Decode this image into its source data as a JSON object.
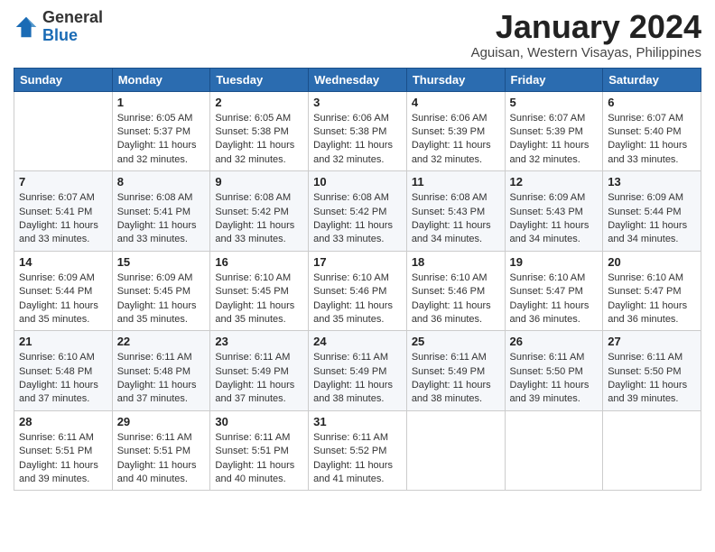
{
  "header": {
    "logo_general": "General",
    "logo_blue": "Blue",
    "month_title": "January 2024",
    "location": "Aguisan, Western Visayas, Philippines"
  },
  "weekdays": [
    "Sunday",
    "Monday",
    "Tuesday",
    "Wednesday",
    "Thursday",
    "Friday",
    "Saturday"
  ],
  "weeks": [
    [
      {
        "day": "",
        "info": ""
      },
      {
        "day": "1",
        "info": "Sunrise: 6:05 AM\nSunset: 5:37 PM\nDaylight: 11 hours\nand 32 minutes."
      },
      {
        "day": "2",
        "info": "Sunrise: 6:05 AM\nSunset: 5:38 PM\nDaylight: 11 hours\nand 32 minutes."
      },
      {
        "day": "3",
        "info": "Sunrise: 6:06 AM\nSunset: 5:38 PM\nDaylight: 11 hours\nand 32 minutes."
      },
      {
        "day": "4",
        "info": "Sunrise: 6:06 AM\nSunset: 5:39 PM\nDaylight: 11 hours\nand 32 minutes."
      },
      {
        "day": "5",
        "info": "Sunrise: 6:07 AM\nSunset: 5:39 PM\nDaylight: 11 hours\nand 32 minutes."
      },
      {
        "day": "6",
        "info": "Sunrise: 6:07 AM\nSunset: 5:40 PM\nDaylight: 11 hours\nand 33 minutes."
      }
    ],
    [
      {
        "day": "7",
        "info": "Sunrise: 6:07 AM\nSunset: 5:41 PM\nDaylight: 11 hours\nand 33 minutes."
      },
      {
        "day": "8",
        "info": "Sunrise: 6:08 AM\nSunset: 5:41 PM\nDaylight: 11 hours\nand 33 minutes."
      },
      {
        "day": "9",
        "info": "Sunrise: 6:08 AM\nSunset: 5:42 PM\nDaylight: 11 hours\nand 33 minutes."
      },
      {
        "day": "10",
        "info": "Sunrise: 6:08 AM\nSunset: 5:42 PM\nDaylight: 11 hours\nand 33 minutes."
      },
      {
        "day": "11",
        "info": "Sunrise: 6:08 AM\nSunset: 5:43 PM\nDaylight: 11 hours\nand 34 minutes."
      },
      {
        "day": "12",
        "info": "Sunrise: 6:09 AM\nSunset: 5:43 PM\nDaylight: 11 hours\nand 34 minutes."
      },
      {
        "day": "13",
        "info": "Sunrise: 6:09 AM\nSunset: 5:44 PM\nDaylight: 11 hours\nand 34 minutes."
      }
    ],
    [
      {
        "day": "14",
        "info": "Sunrise: 6:09 AM\nSunset: 5:44 PM\nDaylight: 11 hours\nand 35 minutes."
      },
      {
        "day": "15",
        "info": "Sunrise: 6:09 AM\nSunset: 5:45 PM\nDaylight: 11 hours\nand 35 minutes."
      },
      {
        "day": "16",
        "info": "Sunrise: 6:10 AM\nSunset: 5:45 PM\nDaylight: 11 hours\nand 35 minutes."
      },
      {
        "day": "17",
        "info": "Sunrise: 6:10 AM\nSunset: 5:46 PM\nDaylight: 11 hours\nand 35 minutes."
      },
      {
        "day": "18",
        "info": "Sunrise: 6:10 AM\nSunset: 5:46 PM\nDaylight: 11 hours\nand 36 minutes."
      },
      {
        "day": "19",
        "info": "Sunrise: 6:10 AM\nSunset: 5:47 PM\nDaylight: 11 hours\nand 36 minutes."
      },
      {
        "day": "20",
        "info": "Sunrise: 6:10 AM\nSunset: 5:47 PM\nDaylight: 11 hours\nand 36 minutes."
      }
    ],
    [
      {
        "day": "21",
        "info": "Sunrise: 6:10 AM\nSunset: 5:48 PM\nDaylight: 11 hours\nand 37 minutes."
      },
      {
        "day": "22",
        "info": "Sunrise: 6:11 AM\nSunset: 5:48 PM\nDaylight: 11 hours\nand 37 minutes."
      },
      {
        "day": "23",
        "info": "Sunrise: 6:11 AM\nSunset: 5:49 PM\nDaylight: 11 hours\nand 37 minutes."
      },
      {
        "day": "24",
        "info": "Sunrise: 6:11 AM\nSunset: 5:49 PM\nDaylight: 11 hours\nand 38 minutes."
      },
      {
        "day": "25",
        "info": "Sunrise: 6:11 AM\nSunset: 5:49 PM\nDaylight: 11 hours\nand 38 minutes."
      },
      {
        "day": "26",
        "info": "Sunrise: 6:11 AM\nSunset: 5:50 PM\nDaylight: 11 hours\nand 39 minutes."
      },
      {
        "day": "27",
        "info": "Sunrise: 6:11 AM\nSunset: 5:50 PM\nDaylight: 11 hours\nand 39 minutes."
      }
    ],
    [
      {
        "day": "28",
        "info": "Sunrise: 6:11 AM\nSunset: 5:51 PM\nDaylight: 11 hours\nand 39 minutes."
      },
      {
        "day": "29",
        "info": "Sunrise: 6:11 AM\nSunset: 5:51 PM\nDaylight: 11 hours\nand 40 minutes."
      },
      {
        "day": "30",
        "info": "Sunrise: 6:11 AM\nSunset: 5:51 PM\nDaylight: 11 hours\nand 40 minutes."
      },
      {
        "day": "31",
        "info": "Sunrise: 6:11 AM\nSunset: 5:52 PM\nDaylight: 11 hours\nand 41 minutes."
      },
      {
        "day": "",
        "info": ""
      },
      {
        "day": "",
        "info": ""
      },
      {
        "day": "",
        "info": ""
      }
    ]
  ]
}
